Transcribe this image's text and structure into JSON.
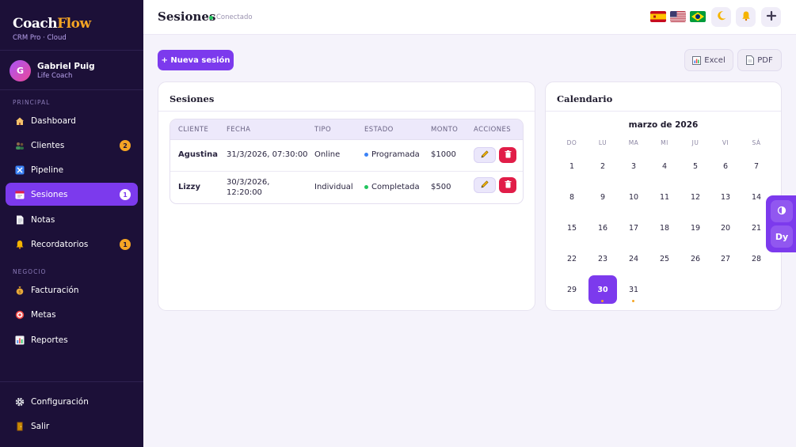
{
  "brand": {
    "name_part1": "Coach",
    "name_part2": "Flow",
    "subtitle": "CRM Pro · Cloud"
  },
  "user": {
    "initial": "G",
    "name": "Gabriel Puig",
    "role": "Life Coach"
  },
  "sidebar": {
    "section_principal": "PRINCIPAL",
    "section_negocio": "NEGOCIO",
    "items": [
      {
        "label": "Dashboard",
        "icon": "home-icon"
      },
      {
        "label": "Clientes",
        "icon": "users-icon",
        "badge": "2"
      },
      {
        "label": "Pipeline",
        "icon": "pipeline-icon"
      },
      {
        "label": "Sesiones",
        "icon": "calendar-icon",
        "badge": "1",
        "active": true
      },
      {
        "label": "Notas",
        "icon": "notes-icon"
      },
      {
        "label": "Recordatorios",
        "icon": "bell-icon",
        "badge": "1"
      },
      {
        "label": "Facturación",
        "icon": "money-bag-icon"
      },
      {
        "label": "Metas",
        "icon": "target-icon"
      },
      {
        "label": "Reportes",
        "icon": "chart-icon"
      }
    ],
    "footer": [
      {
        "label": "Configuración",
        "icon": "gear-icon"
      },
      {
        "label": "Salir",
        "icon": "door-icon"
      }
    ]
  },
  "header": {
    "title": "Sesiones",
    "status": "Conectado",
    "flags": [
      "flag-es",
      "flag-us",
      "flag-br"
    ]
  },
  "toolbar": {
    "new_session": "+ Nueva sesión",
    "excel": "Excel",
    "pdf": "PDF"
  },
  "sessions": {
    "title": "Sesiones",
    "columns": [
      "CLIENTE",
      "FECHA",
      "TIPO",
      "ESTADO",
      "MONTO",
      "ACCIONES"
    ],
    "rows": [
      {
        "cliente": "Agustina",
        "fecha": "31/3/2026, 07:30:00",
        "tipo": "Online",
        "estado": "Programada",
        "estado_color": "#3b82f6",
        "monto": "$1000"
      },
      {
        "cliente": "Lizzy",
        "fecha_line1": "30/3/2026,",
        "fecha_line2": "12:20:00",
        "tipo": "Individual",
        "estado": "Completada",
        "estado_color": "#22c55e",
        "monto": "$500"
      }
    ]
  },
  "calendar": {
    "title": "Calendario",
    "month": "marzo de 2026",
    "weekdays": [
      "DO",
      "LU",
      "MA",
      "MI",
      "JU",
      "VI",
      "SÁ"
    ],
    "weeks": [
      [
        "1",
        "2",
        "3",
        "4",
        "5",
        "6",
        "7"
      ],
      [
        "8",
        "9",
        "10",
        "11",
        "12",
        "13",
        "14"
      ],
      [
        "15",
        "16",
        "17",
        "18",
        "19",
        "20",
        "21"
      ],
      [
        "22",
        "23",
        "24",
        "25",
        "26",
        "27",
        "28"
      ],
      [
        "29",
        "30",
        "31"
      ]
    ],
    "today": "30",
    "event_days": [
      {
        "day": "30",
        "color": "#f5a524"
      },
      {
        "day": "31",
        "color": "#f5a524"
      }
    ]
  },
  "floating": {
    "contrast_icon": "contrast-icon",
    "dyslexia_label": "Dy"
  }
}
